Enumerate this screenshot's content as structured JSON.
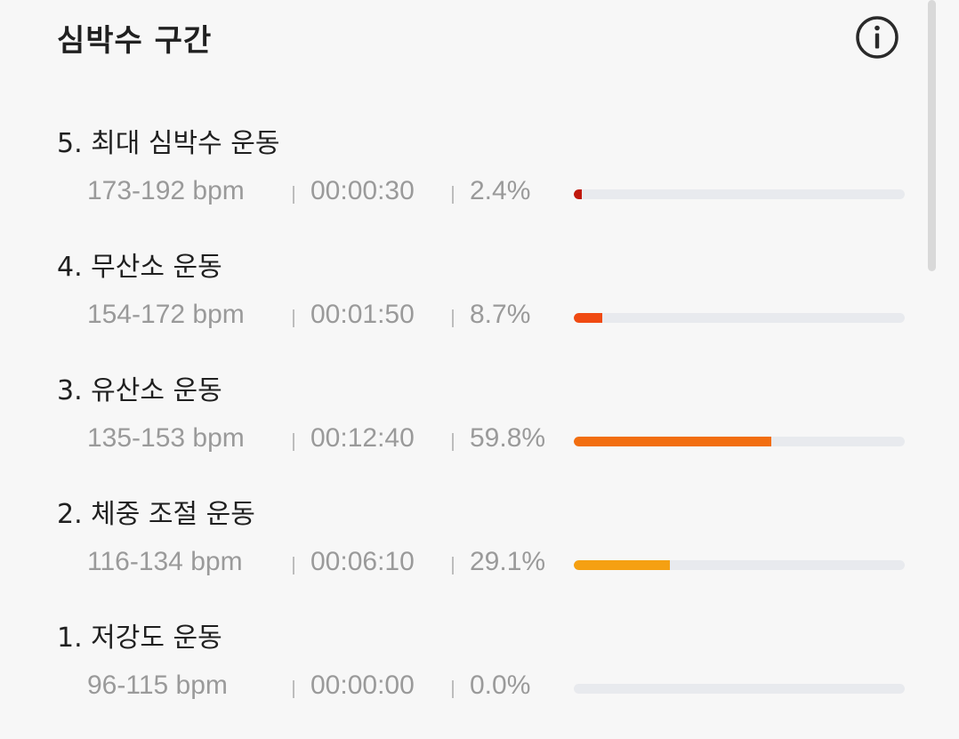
{
  "header": {
    "title": "심박수 구간",
    "info_icon": "info-circle-icon"
  },
  "zones": [
    {
      "name": "5. 최대 심박수 운동",
      "bpm": "173-192 bpm",
      "time": "00:00:30",
      "percent_label": "2.4%",
      "percent": 2.4,
      "color": "#c0180c"
    },
    {
      "name": "4. 무산소 운동",
      "bpm": "154-172 bpm",
      "time": "00:01:50",
      "percent_label": "8.7%",
      "percent": 8.7,
      "color": "#f04a12"
    },
    {
      "name": "3. 유산소 운동",
      "bpm": "135-153 bpm",
      "time": "00:12:40",
      "percent_label": "59.8%",
      "percent": 59.8,
      "color": "#f26e10"
    },
    {
      "name": "2. 체중 조절 운동",
      "bpm": "116-134 bpm",
      "time": "00:06:10",
      "percent_label": "29.1%",
      "percent": 29.1,
      "color": "#f5a012"
    },
    {
      "name": "1. 저강도 운동",
      "bpm": "96-115 bpm",
      "time": "00:00:00",
      "percent_label": "0.0%",
      "percent": 0.0,
      "color": "#f5c012"
    }
  ]
}
